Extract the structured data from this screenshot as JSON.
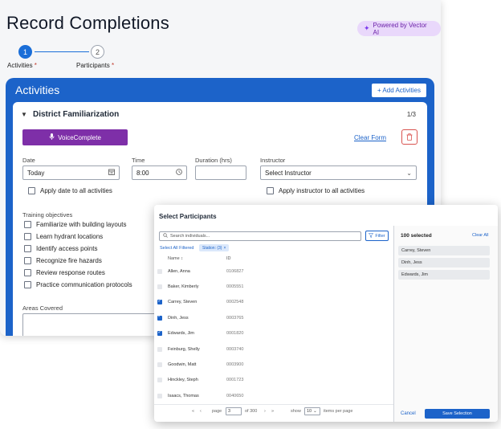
{
  "page": {
    "title": "Record Completions",
    "ai_badge": "Powered by Vector AI"
  },
  "stepper": {
    "steps": [
      {
        "number": "1",
        "label": "Activities",
        "required_mark": "*",
        "state": "active"
      },
      {
        "number": "2",
        "label": "Participants",
        "required_mark": "*",
        "state": "inactive"
      }
    ]
  },
  "activities": {
    "title": "Activities",
    "add_button": "+ Add Activities",
    "card": {
      "name": "District Familiarization",
      "count": "1/3",
      "voice_button": "VoiceComplete",
      "clear_form": "Clear Form",
      "date": {
        "label": "Date",
        "value": "Today"
      },
      "time": {
        "label": "Time",
        "value": "8:00"
      },
      "duration": {
        "label": "Duration (hrs)",
        "value": ""
      },
      "instructor": {
        "label": "Instructor",
        "value": "Select Instructor"
      },
      "apply_date": "Apply date to all activities",
      "apply_instructor": "Apply instructor to all activities",
      "objectives_title": "Training objectives",
      "objectives": [
        "Familiarize with building layouts",
        "Learn hydrant locations",
        "Identify access points",
        "Recognize fire hazards",
        "Review response routes",
        "Practice communication protocols"
      ],
      "areas_label": "Areas Covered"
    }
  },
  "modal": {
    "title": "Select Participants",
    "search_placeholder": "Search individuals...",
    "filter_button": "Filter",
    "select_all_filtered": "Select All Filtered",
    "chip": "Station: (3)",
    "columns": {
      "name": "Name",
      "id": "ID"
    },
    "rows": [
      {
        "name": "Allen, Anna",
        "id": "0106827",
        "checked": false
      },
      {
        "name": "Baker, Kimberly",
        "id": "0005551",
        "checked": false
      },
      {
        "name": "Carrey, Steven",
        "id": "0002548",
        "checked": true
      },
      {
        "name": "Dinh, Jess",
        "id": "0003765",
        "checked": true
      },
      {
        "name": "Edwards, Jim",
        "id": "0001820",
        "checked": true
      },
      {
        "name": "Feinburg, Shelly",
        "id": "0003740",
        "checked": false
      },
      {
        "name": "Goodwin, Matt",
        "id": "0003900",
        "checked": false
      },
      {
        "name": "Hinckley, Steph",
        "id": "0001723",
        "checked": false
      },
      {
        "name": "Isaacs, Thomas",
        "id": "0040650",
        "checked": false
      }
    ],
    "pager": {
      "page_label": "page",
      "page_value": "3",
      "of_label": "of 300",
      "show_label": "show",
      "show_value": "10",
      "per_page_label": "items per page"
    },
    "selected_count": "100 selected",
    "clear_all": "Clear All",
    "selected": [
      "Carrey, Steven",
      "Dinh, Jess",
      "Edwards, Jim"
    ],
    "cancel": "Cancel",
    "save": "Save Selection"
  },
  "colors": {
    "primary": "#1c63c9",
    "voice_purple": "#7e2fa8",
    "badge_bg": "#e9d8fb",
    "danger": "#d9534f"
  }
}
